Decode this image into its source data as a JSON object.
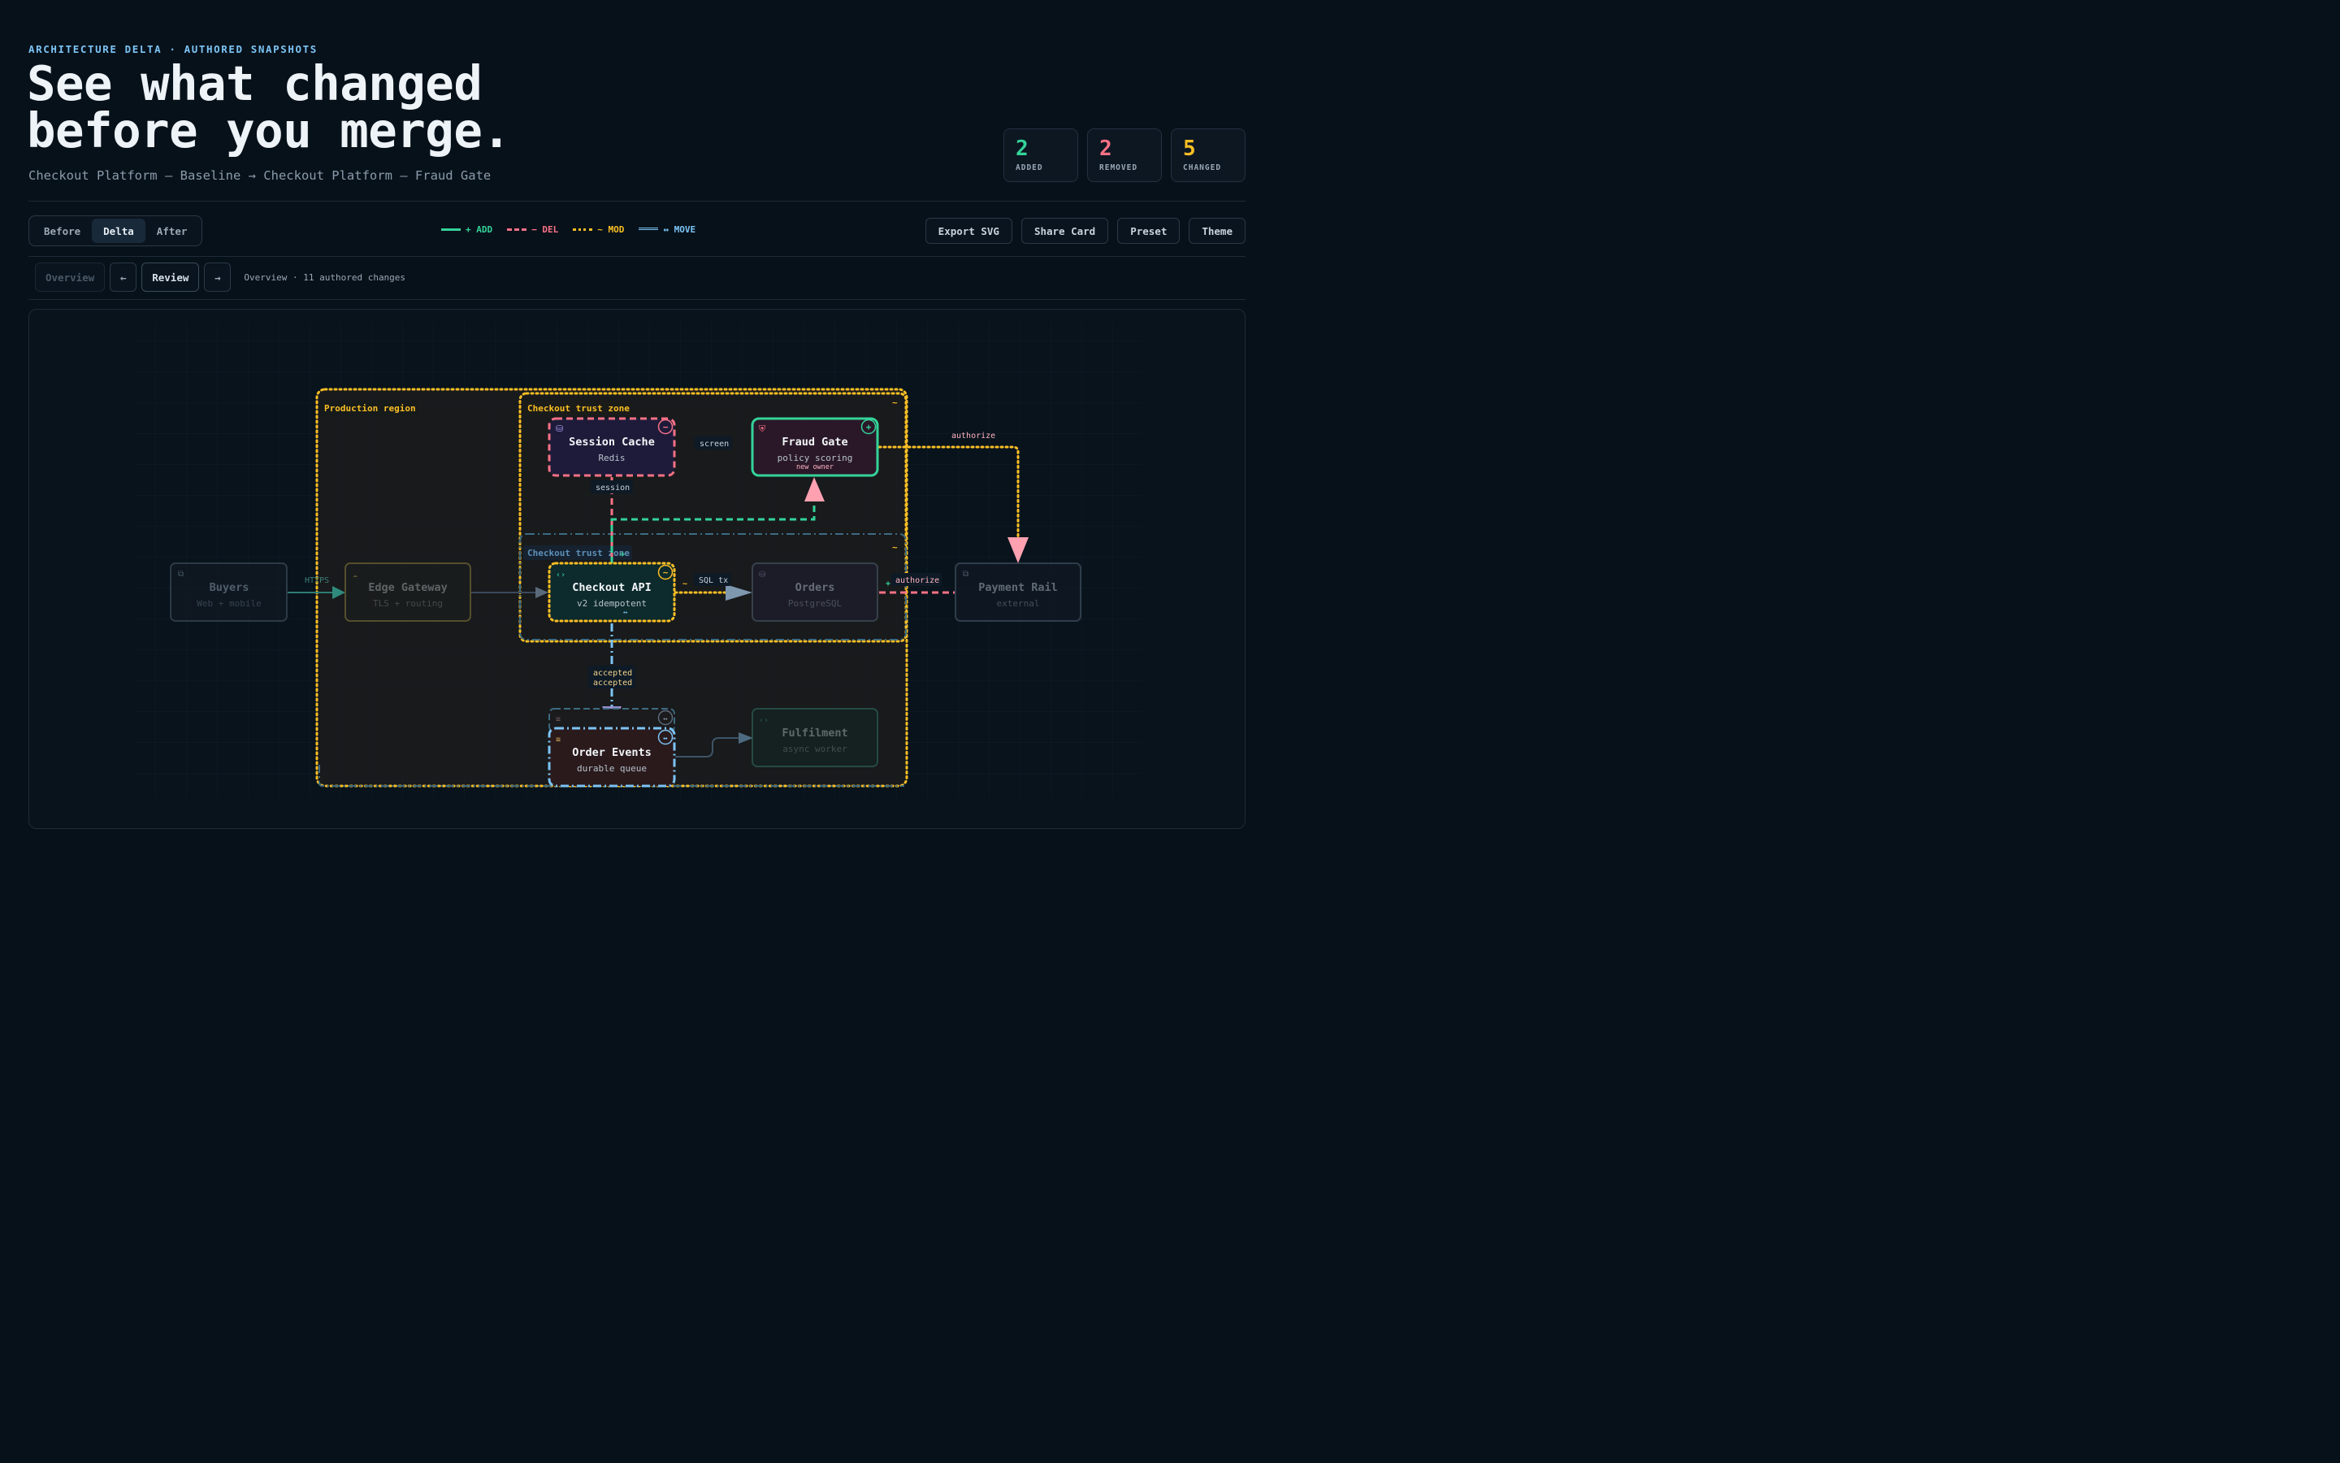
{
  "header": {
    "eyebrow": "ARCHITECTURE DELTA · AUTHORED SNAPSHOTS",
    "title_line1": "See what changed",
    "title_line2": "before you merge.",
    "subtitle": "Checkout Platform — Baseline → Checkout Platform — Fraud Gate"
  },
  "stats": [
    {
      "value": "2",
      "label": "ADDED",
      "color": "#34d399"
    },
    {
      "value": "2",
      "label": "REMOVED",
      "color": "#f87185"
    },
    {
      "value": "5",
      "label": "CHANGED",
      "color": "#fbbf24"
    }
  ],
  "view_toggle": {
    "before": "Before",
    "delta": "Delta",
    "after": "After",
    "active": "Delta"
  },
  "legend": [
    {
      "text": "+ ADD",
      "color": "#34d399",
      "style": "solid"
    },
    {
      "text": "− DEL",
      "color": "#f87185",
      "style": "dashed"
    },
    {
      "text": "~ MOD",
      "color": "#fbbf24",
      "style": "dotted"
    },
    {
      "text": "↔ MOVE",
      "color": "#7cc4f5",
      "style": "double"
    }
  ],
  "actions": {
    "export": "Export SVG",
    "share": "Share Card",
    "preset": "Preset",
    "theme": "Theme"
  },
  "review_bar": {
    "overview": "Overview",
    "prev": "←",
    "review": "Review",
    "next": "→",
    "note": "Overview · 11 authored changes"
  },
  "diagram": {
    "groups": {
      "production": "Production region",
      "trust_top": "Checkout trust zone",
      "trust_moved": "Checkout trust zone",
      "mod_marker": "~"
    },
    "nodes": {
      "buyers": {
        "title": "Buyers",
        "sub": "Web + mobile"
      },
      "edge": {
        "title": "Edge Gateway",
        "sub": "TLS + routing"
      },
      "session": {
        "title": "Session Cache",
        "sub": "Redis",
        "badge": "−"
      },
      "fraud": {
        "title": "Fraud Gate",
        "sub": "policy scoring",
        "note": "new owner",
        "badge": "+"
      },
      "checkout": {
        "title": "Checkout API",
        "sub": "v2 idempotent",
        "badge": "~",
        "move": "↔"
      },
      "orders": {
        "title": "Orders",
        "sub": "PostgreSQL"
      },
      "payment": {
        "title": "Payment Rail",
        "sub": "external"
      },
      "events": {
        "title": "Order Events",
        "sub": "durable queue",
        "badge": "↔",
        "ghost_badge": "↔"
      },
      "fulfilment": {
        "title": "Fulfilment",
        "sub": "async worker"
      }
    },
    "edges": {
      "https": "HTTPS",
      "screen": "screen",
      "session": "session",
      "authorize_fraud": "authorize",
      "sql": "SQL tx",
      "sql_mod": "~",
      "authorize_orders": "authorize",
      "authorize_plus": "+",
      "accepted1": "accepted",
      "accepted2": "accepted",
      "trust_plus": "+"
    }
  }
}
